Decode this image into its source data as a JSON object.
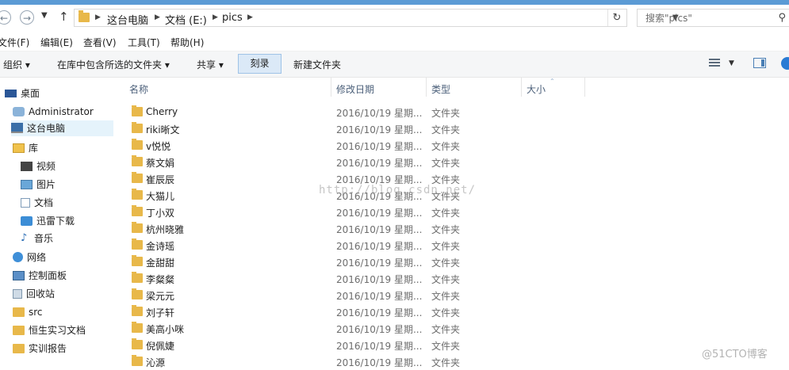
{
  "address": {
    "crumbs": [
      "这台电脑",
      "文档 (E:)",
      "pics"
    ]
  },
  "search": {
    "placeholder": "搜索\"pics\""
  },
  "menu": [
    "文件(F)",
    "编辑(E)",
    "查看(V)",
    "工具(T)",
    "帮助(H)"
  ],
  "toolbar": {
    "organize": "组织 ▾",
    "include": "在库中包含所选的文件夹 ▾",
    "share": "共享 ▾",
    "burn": "刻录",
    "new_folder": "新建文件夹"
  },
  "nav": [
    {
      "label": "桌面",
      "icon": "desktop-icon"
    },
    {
      "label": "Administrator",
      "icon": "user-icon"
    },
    {
      "label": "这台电脑",
      "icon": "computer-icon"
    },
    {
      "label": "库",
      "icon": "library-icon"
    },
    {
      "label": "视频",
      "icon": "video-icon"
    },
    {
      "label": "图片",
      "icon": "picture-icon"
    },
    {
      "label": "文档",
      "icon": "document-icon"
    },
    {
      "label": "迅雷下载",
      "icon": "download-icon"
    },
    {
      "label": "音乐",
      "icon": "music-icon"
    },
    {
      "label": "网络",
      "icon": "network-icon"
    },
    {
      "label": "控制面板",
      "icon": "control-panel-icon"
    },
    {
      "label": "回收站",
      "icon": "recycle-bin-icon"
    },
    {
      "label": "src",
      "icon": "folder-icon"
    },
    {
      "label": "恒生实习文档",
      "icon": "folder-icon"
    },
    {
      "label": "实训报告",
      "icon": "folder-icon"
    }
  ],
  "columns": {
    "name": "名称",
    "date": "修改日期",
    "type": "类型",
    "size": "大小"
  },
  "files": [
    {
      "name": "Cherry",
      "date": "2016/10/19 星期...",
      "type": "文件夹"
    },
    {
      "name": "riki晰文",
      "date": "2016/10/19 星期...",
      "type": "文件夹"
    },
    {
      "name": "v悦悦",
      "date": "2016/10/19 星期...",
      "type": "文件夹"
    },
    {
      "name": "蔡文娟",
      "date": "2016/10/19 星期...",
      "type": "文件夹"
    },
    {
      "name": "崔辰辰",
      "date": "2016/10/19 星期...",
      "type": "文件夹"
    },
    {
      "name": "大猫儿",
      "date": "2016/10/19 星期...",
      "type": "文件夹"
    },
    {
      "name": "丁小双",
      "date": "2016/10/19 星期...",
      "type": "文件夹"
    },
    {
      "name": "杭州晓雅",
      "date": "2016/10/19 星期...",
      "type": "文件夹"
    },
    {
      "name": "金诗瑶",
      "date": "2016/10/19 星期...",
      "type": "文件夹"
    },
    {
      "name": "金甜甜",
      "date": "2016/10/19 星期...",
      "type": "文件夹"
    },
    {
      "name": "李粲粲",
      "date": "2016/10/19 星期...",
      "type": "文件夹"
    },
    {
      "name": "梁元元",
      "date": "2016/10/19 星期...",
      "type": "文件夹"
    },
    {
      "name": "刘子轩",
      "date": "2016/10/19 星期...",
      "type": "文件夹"
    },
    {
      "name": "美高小咪",
      "date": "2016/10/19 星期...",
      "type": "文件夹"
    },
    {
      "name": "倪佩婕",
      "date": "2016/10/19 星期...",
      "type": "文件夹"
    },
    {
      "name": "沁源",
      "date": "2016/10/19 星期...",
      "type": "文件夹"
    }
  ],
  "watermark": {
    "url": "http://blog.csdn.net/",
    "site": "@51CTO博客"
  },
  "colors": {
    "accent": "#5b9bd5",
    "folder": "#e8b84a",
    "selected": "#e5f3fb",
    "burn_bg": "#dbe9f7"
  }
}
